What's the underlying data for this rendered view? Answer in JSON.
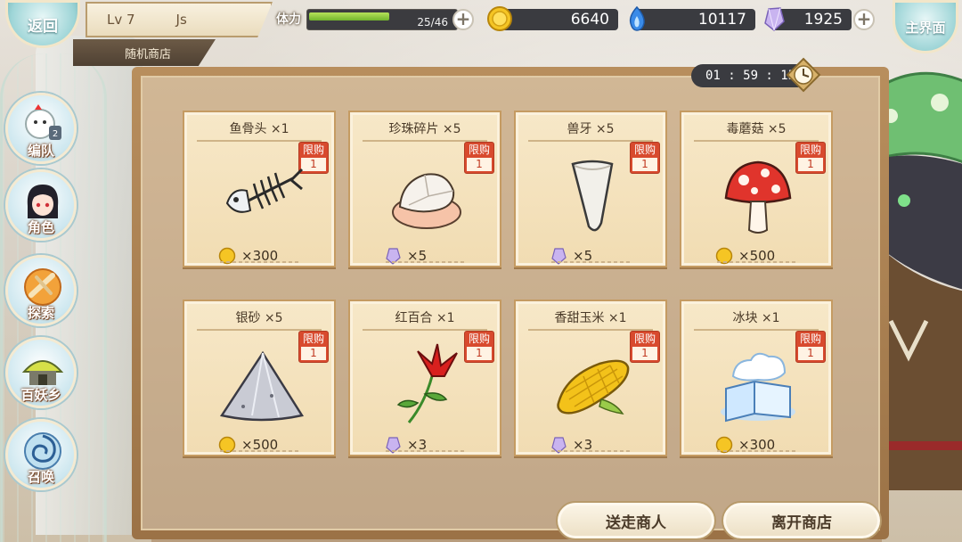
{
  "header": {
    "back_label": "返回",
    "home_label": "主界面",
    "level": "Lv 7",
    "player_name": "Js",
    "shop_title": "随机商店"
  },
  "stamina": {
    "label": "体力",
    "text": "25/46",
    "current": 25,
    "max": 46
  },
  "resources": {
    "gold": "6640",
    "spirit": "10117",
    "crystal": "1925"
  },
  "timer": "01 : 59 : 15",
  "nav": [
    {
      "label": "编队",
      "badge": "2"
    },
    {
      "label": "角色"
    },
    {
      "label": "探索"
    },
    {
      "label": "百妖乡"
    },
    {
      "label": "召唤"
    }
  ],
  "limit_label": "限购",
  "items": [
    {
      "name": "鱼骨头 ×1",
      "limit": "1",
      "currency": "gold",
      "price": "×300",
      "icon": "fishbone-icon"
    },
    {
      "name": "珍珠碎片 ×5",
      "limit": "1",
      "currency": "crystal",
      "price": "×5",
      "icon": "pearl-shard-icon"
    },
    {
      "name": "兽牙 ×5",
      "limit": "1",
      "currency": "crystal",
      "price": "×5",
      "icon": "fang-icon"
    },
    {
      "name": "毒蘑菇 ×5",
      "limit": "1",
      "currency": "gold",
      "price": "×500",
      "icon": "mushroom-icon"
    },
    {
      "name": "银砂 ×5",
      "limit": "1",
      "currency": "gold",
      "price": "×500",
      "icon": "silver-sand-icon"
    },
    {
      "name": "红百合 ×1",
      "limit": "1",
      "currency": "crystal",
      "price": "×3",
      "icon": "red-lily-icon"
    },
    {
      "name": "香甜玉米 ×1",
      "limit": "1",
      "currency": "crystal",
      "price": "×3",
      "icon": "corn-icon"
    },
    {
      "name": "冰块 ×1",
      "limit": "1",
      "currency": "gold",
      "price": "×300",
      "icon": "ice-cube-icon"
    }
  ],
  "buttons": {
    "dismiss_merchant": "送走商人",
    "leave_shop": "离开商店"
  },
  "colors": {
    "limit_badge": "#d84a2e",
    "stamina_fill": "#71b52c",
    "card_bg": "#f5e4c0"
  }
}
